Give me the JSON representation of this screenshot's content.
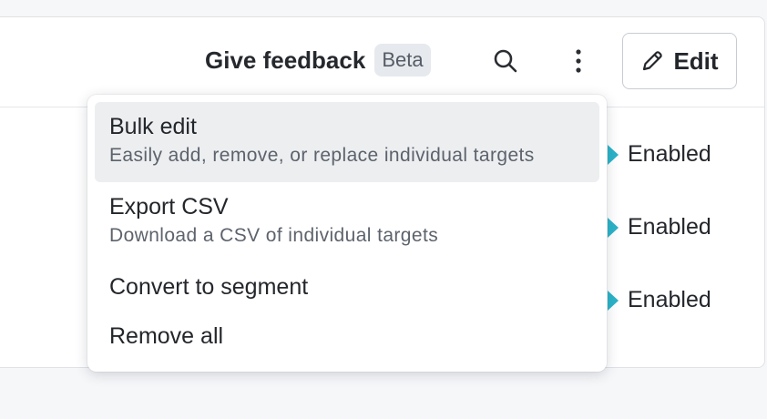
{
  "header": {
    "feedback_label": "Give feedback",
    "beta_badge": "Beta",
    "edit_label": "Edit",
    "icons": {
      "search": "search-icon",
      "more": "more-vertical-icon",
      "edit": "pencil-icon"
    }
  },
  "rows": [
    {
      "status": "Enabled"
    },
    {
      "status": "Enabled"
    },
    {
      "status": "Enabled"
    }
  ],
  "menu": {
    "items": [
      {
        "title": "Bulk edit",
        "description": "Easily add, remove, or replace individual targets"
      },
      {
        "title": "Export CSV",
        "description": "Download a CSV of individual targets"
      },
      {
        "title": "Convert to segment"
      },
      {
        "title": "Remove all"
      }
    ]
  },
  "colors": {
    "accent": "#2bb3c9",
    "active_item_bg": "#eceef0",
    "page_bg": "#f6f7f9"
  }
}
